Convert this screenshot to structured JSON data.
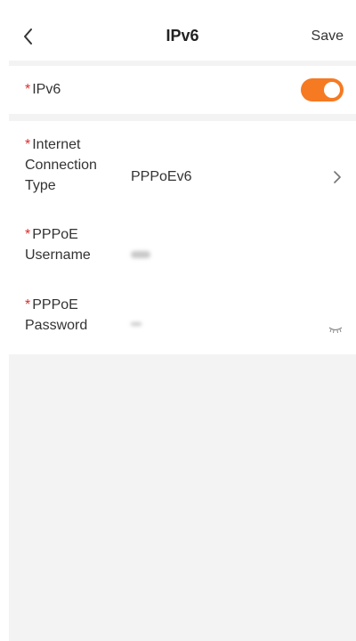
{
  "header": {
    "title": "IPv6",
    "save_label": "Save"
  },
  "ipv6": {
    "required_mark": "*",
    "label": "IPv6",
    "enabled": true,
    "toggle_color": "#F57A22"
  },
  "settings": {
    "connection_type": {
      "required_mark": "*",
      "label_lines": [
        "Internet",
        "Connection",
        "Type"
      ],
      "value": "PPPoEv6"
    },
    "username": {
      "required_mark": "*",
      "label_lines": [
        "PPPoE",
        "Username"
      ],
      "value": ""
    },
    "password": {
      "required_mark": "*",
      "label_lines": [
        "PPPoE",
        "Password"
      ],
      "value": ""
    }
  },
  "icons": {
    "back": "chevron-left-icon",
    "next": "chevron-right-icon",
    "password": "eye-closed-icon"
  }
}
